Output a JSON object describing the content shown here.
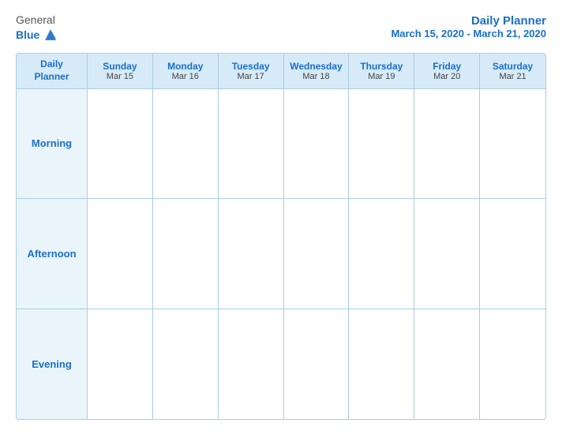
{
  "header": {
    "logo_general": "General",
    "logo_blue": "Blue",
    "title": "Daily Planner",
    "date_range": "March 15, 2020 - March 21, 2020"
  },
  "calendar": {
    "label_daily": "Daily",
    "label_planner": "Planner",
    "columns": [
      {
        "day": "Sunday",
        "date": "Mar 15"
      },
      {
        "day": "Monday",
        "date": "Mar 16"
      },
      {
        "day": "Tuesday",
        "date": "Mar 17"
      },
      {
        "day": "Wednesday",
        "date": "Mar 18"
      },
      {
        "day": "Thursday",
        "date": "Mar 19"
      },
      {
        "day": "Friday",
        "date": "Mar 20"
      },
      {
        "day": "Saturday",
        "date": "Mar 21"
      }
    ],
    "rows": [
      {
        "label": "Morning"
      },
      {
        "label": "Afternoon"
      },
      {
        "label": "Evening"
      }
    ]
  }
}
